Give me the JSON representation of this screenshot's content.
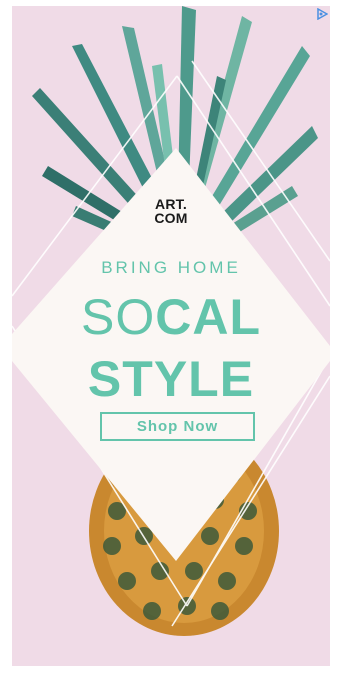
{
  "ad": {
    "logo_line1": "ART.",
    "logo_line2": "COM",
    "kicker": "BRING HOME",
    "headline_thin": "SO",
    "headline_bold": "CAL",
    "headline_line2": "STYLE",
    "cta_label": "Shop Now",
    "adchoices_icon": "adchoices-triangle-icon"
  },
  "colors": {
    "background": "#f0dbe7",
    "panel": "#fbf7f4",
    "accent": "#63c4ab",
    "logo": "#1a1a1a",
    "adchoices": "#4a90e2"
  }
}
